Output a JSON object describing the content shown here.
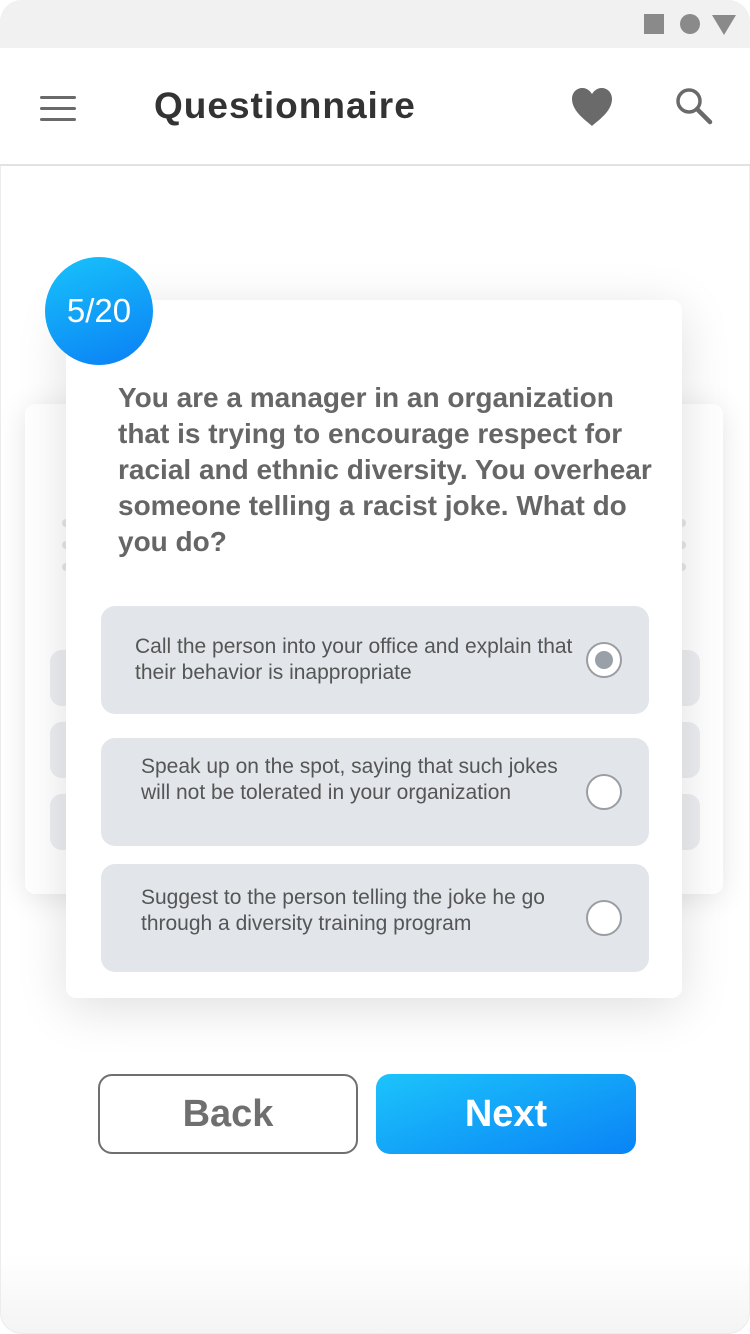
{
  "app": {
    "title": "Questionnaire",
    "accent_color": "#0a85f6",
    "icons": [
      "menu-icon",
      "heart-icon",
      "search-icon"
    ]
  },
  "status_bar": {
    "icons": [
      "square-icon",
      "circle-icon",
      "triangle-icon"
    ]
  },
  "question": {
    "progress": "5/20",
    "text": "You are a manager in an organization that is trying to encourage respect for racial and ethnic diversity. You overhear someone telling a racist joke. What do you do?",
    "options": [
      {
        "label": "Call the person into your office and explain that their behavior is inappropriate",
        "selected": true
      },
      {
        "label": "Speak up on the spot, saying that such jokes will not be tolerated in your organization",
        "selected": false
      },
      {
        "label": "Suggest to the person telling the joke he go through a diversity training program",
        "selected": false
      }
    ]
  },
  "actions": {
    "back_label": "Back",
    "next_label": "Next"
  }
}
